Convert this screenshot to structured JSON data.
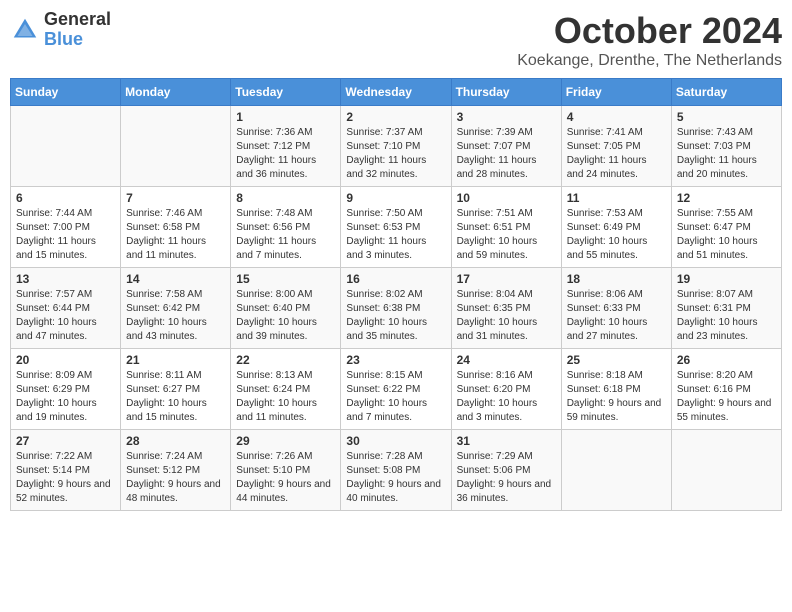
{
  "logo": {
    "general": "General",
    "blue": "Blue"
  },
  "title": {
    "month": "October 2024",
    "location": "Koekange, Drenthe, The Netherlands"
  },
  "headers": [
    "Sunday",
    "Monday",
    "Tuesday",
    "Wednesday",
    "Thursday",
    "Friday",
    "Saturday"
  ],
  "weeks": [
    [
      {
        "day": "",
        "info": ""
      },
      {
        "day": "",
        "info": ""
      },
      {
        "day": "1",
        "info": "Sunrise: 7:36 AM\nSunset: 7:12 PM\nDaylight: 11 hours and 36 minutes."
      },
      {
        "day": "2",
        "info": "Sunrise: 7:37 AM\nSunset: 7:10 PM\nDaylight: 11 hours and 32 minutes."
      },
      {
        "day": "3",
        "info": "Sunrise: 7:39 AM\nSunset: 7:07 PM\nDaylight: 11 hours and 28 minutes."
      },
      {
        "day": "4",
        "info": "Sunrise: 7:41 AM\nSunset: 7:05 PM\nDaylight: 11 hours and 24 minutes."
      },
      {
        "day": "5",
        "info": "Sunrise: 7:43 AM\nSunset: 7:03 PM\nDaylight: 11 hours and 20 minutes."
      }
    ],
    [
      {
        "day": "6",
        "info": "Sunrise: 7:44 AM\nSunset: 7:00 PM\nDaylight: 11 hours and 15 minutes."
      },
      {
        "day": "7",
        "info": "Sunrise: 7:46 AM\nSunset: 6:58 PM\nDaylight: 11 hours and 11 minutes."
      },
      {
        "day": "8",
        "info": "Sunrise: 7:48 AM\nSunset: 6:56 PM\nDaylight: 11 hours and 7 minutes."
      },
      {
        "day": "9",
        "info": "Sunrise: 7:50 AM\nSunset: 6:53 PM\nDaylight: 11 hours and 3 minutes."
      },
      {
        "day": "10",
        "info": "Sunrise: 7:51 AM\nSunset: 6:51 PM\nDaylight: 10 hours and 59 minutes."
      },
      {
        "day": "11",
        "info": "Sunrise: 7:53 AM\nSunset: 6:49 PM\nDaylight: 10 hours and 55 minutes."
      },
      {
        "day": "12",
        "info": "Sunrise: 7:55 AM\nSunset: 6:47 PM\nDaylight: 10 hours and 51 minutes."
      }
    ],
    [
      {
        "day": "13",
        "info": "Sunrise: 7:57 AM\nSunset: 6:44 PM\nDaylight: 10 hours and 47 minutes."
      },
      {
        "day": "14",
        "info": "Sunrise: 7:58 AM\nSunset: 6:42 PM\nDaylight: 10 hours and 43 minutes."
      },
      {
        "day": "15",
        "info": "Sunrise: 8:00 AM\nSunset: 6:40 PM\nDaylight: 10 hours and 39 minutes."
      },
      {
        "day": "16",
        "info": "Sunrise: 8:02 AM\nSunset: 6:38 PM\nDaylight: 10 hours and 35 minutes."
      },
      {
        "day": "17",
        "info": "Sunrise: 8:04 AM\nSunset: 6:35 PM\nDaylight: 10 hours and 31 minutes."
      },
      {
        "day": "18",
        "info": "Sunrise: 8:06 AM\nSunset: 6:33 PM\nDaylight: 10 hours and 27 minutes."
      },
      {
        "day": "19",
        "info": "Sunrise: 8:07 AM\nSunset: 6:31 PM\nDaylight: 10 hours and 23 minutes."
      }
    ],
    [
      {
        "day": "20",
        "info": "Sunrise: 8:09 AM\nSunset: 6:29 PM\nDaylight: 10 hours and 19 minutes."
      },
      {
        "day": "21",
        "info": "Sunrise: 8:11 AM\nSunset: 6:27 PM\nDaylight: 10 hours and 15 minutes."
      },
      {
        "day": "22",
        "info": "Sunrise: 8:13 AM\nSunset: 6:24 PM\nDaylight: 10 hours and 11 minutes."
      },
      {
        "day": "23",
        "info": "Sunrise: 8:15 AM\nSunset: 6:22 PM\nDaylight: 10 hours and 7 minutes."
      },
      {
        "day": "24",
        "info": "Sunrise: 8:16 AM\nSunset: 6:20 PM\nDaylight: 10 hours and 3 minutes."
      },
      {
        "day": "25",
        "info": "Sunrise: 8:18 AM\nSunset: 6:18 PM\nDaylight: 9 hours and 59 minutes."
      },
      {
        "day": "26",
        "info": "Sunrise: 8:20 AM\nSunset: 6:16 PM\nDaylight: 9 hours and 55 minutes."
      }
    ],
    [
      {
        "day": "27",
        "info": "Sunrise: 7:22 AM\nSunset: 5:14 PM\nDaylight: 9 hours and 52 minutes."
      },
      {
        "day": "28",
        "info": "Sunrise: 7:24 AM\nSunset: 5:12 PM\nDaylight: 9 hours and 48 minutes."
      },
      {
        "day": "29",
        "info": "Sunrise: 7:26 AM\nSunset: 5:10 PM\nDaylight: 9 hours and 44 minutes."
      },
      {
        "day": "30",
        "info": "Sunrise: 7:28 AM\nSunset: 5:08 PM\nDaylight: 9 hours and 40 minutes."
      },
      {
        "day": "31",
        "info": "Sunrise: 7:29 AM\nSunset: 5:06 PM\nDaylight: 9 hours and 36 minutes."
      },
      {
        "day": "",
        "info": ""
      },
      {
        "day": "",
        "info": ""
      }
    ]
  ]
}
